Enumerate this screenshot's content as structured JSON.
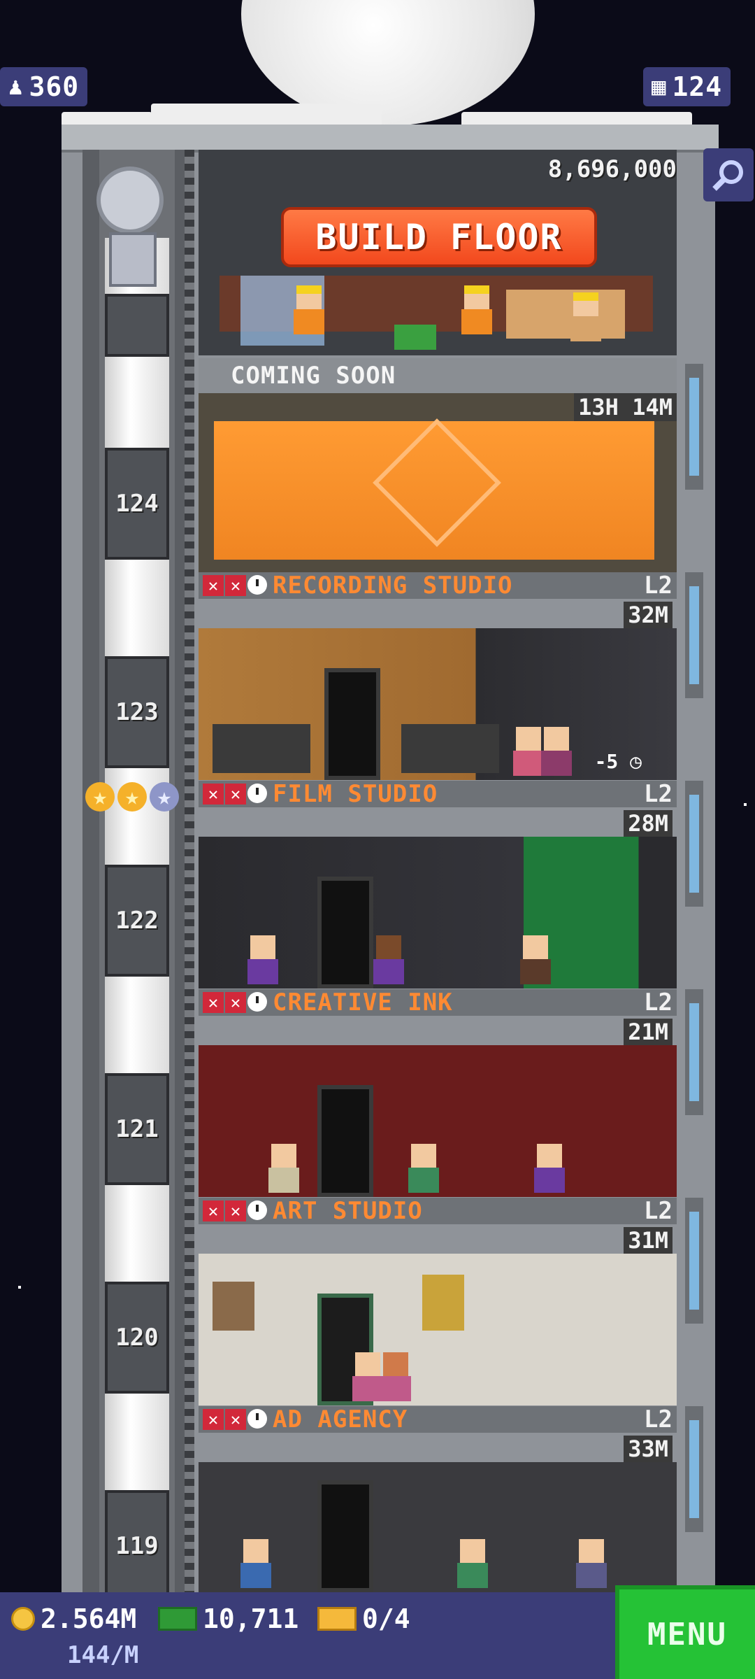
{
  "top_stats": {
    "population": "360",
    "floors": "124"
  },
  "build": {
    "cost": "8,696,000",
    "button_label": "BUILD FLOOR"
  },
  "construction": {
    "label": "COMING SOON",
    "timer": "13H 14M"
  },
  "floors": [
    {
      "number": "124",
      "name": "RECORDING STUDIO",
      "level": "L2",
      "cost": "32M",
      "restock": "-5"
    },
    {
      "number": "123",
      "name": "FILM STUDIO",
      "level": "L2",
      "cost": "28M"
    },
    {
      "number": "122",
      "name": "CREATIVE INK",
      "level": "L2",
      "cost": "21M"
    },
    {
      "number": "121",
      "name": "ART STUDIO",
      "level": "L2",
      "cost": "31M"
    },
    {
      "number": "120",
      "name": "AD AGENCY",
      "level": "L2",
      "cost": "33M"
    },
    {
      "number": "119"
    }
  ],
  "bottom_bar": {
    "coins": "2.564M",
    "income": "144/M",
    "bux": "10,711",
    "tickets": "0/4",
    "menu_label": "MENU"
  },
  "colors": {
    "accent_orange": "#ff8a33",
    "menu_green": "#25c236",
    "panel_blue": "#3b3d78",
    "build_red": "#f2481d"
  }
}
